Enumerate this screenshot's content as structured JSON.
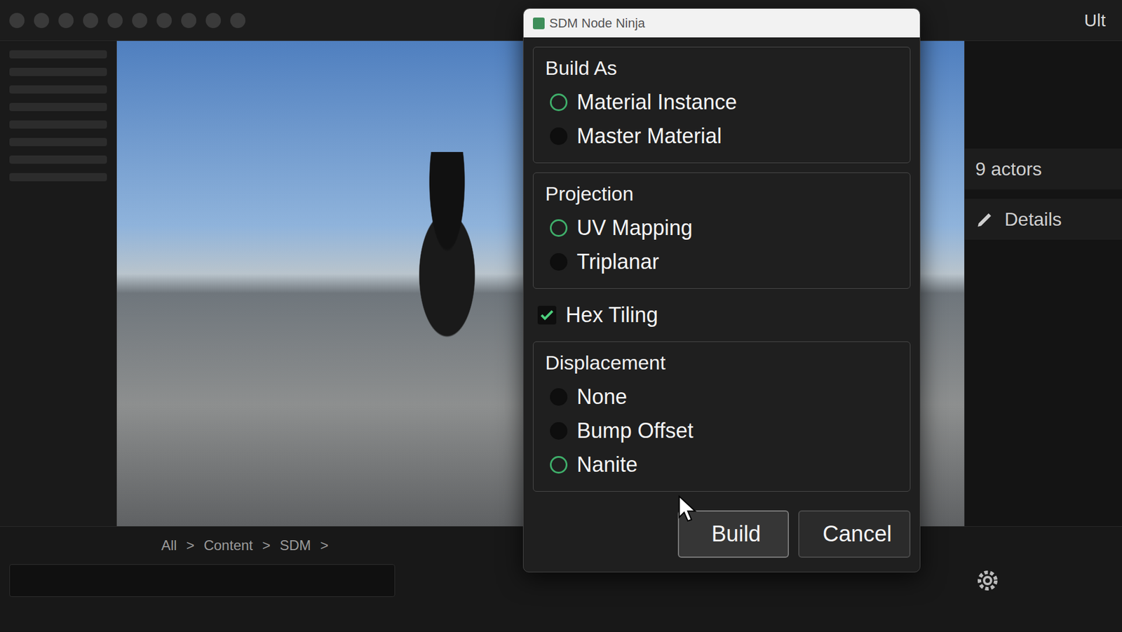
{
  "window": {
    "title": "SDM Node Ninja"
  },
  "toolbar": {
    "corner": "Ult"
  },
  "outliner": {
    "count": "9 actors"
  },
  "details": {
    "label": "Details"
  },
  "breadcrumb": {
    "items": [
      "All",
      "Content",
      "SDM"
    ],
    "separator": ">"
  },
  "dialog": {
    "sections": [
      {
        "kind": "radio",
        "label": "Build As",
        "options": [
          {
            "label": "Material Instance",
            "selected": true
          },
          {
            "label": "Master Material",
            "selected": false
          }
        ]
      },
      {
        "kind": "radio",
        "label": "Projection",
        "options": [
          {
            "label": "UV Mapping",
            "selected": true
          },
          {
            "label": "Triplanar",
            "selected": false
          }
        ]
      },
      {
        "kind": "checkbox",
        "label": "Hex Tiling",
        "checked": true
      },
      {
        "kind": "radio",
        "label": "Displacement",
        "options": [
          {
            "label": "None",
            "selected": false
          },
          {
            "label": "Bump Offset",
            "selected": false
          },
          {
            "label": "Nanite",
            "selected": true
          }
        ]
      }
    ],
    "buttons": [
      {
        "label": "Build",
        "hovered": true
      },
      {
        "label": "Cancel",
        "hovered": false
      }
    ]
  }
}
